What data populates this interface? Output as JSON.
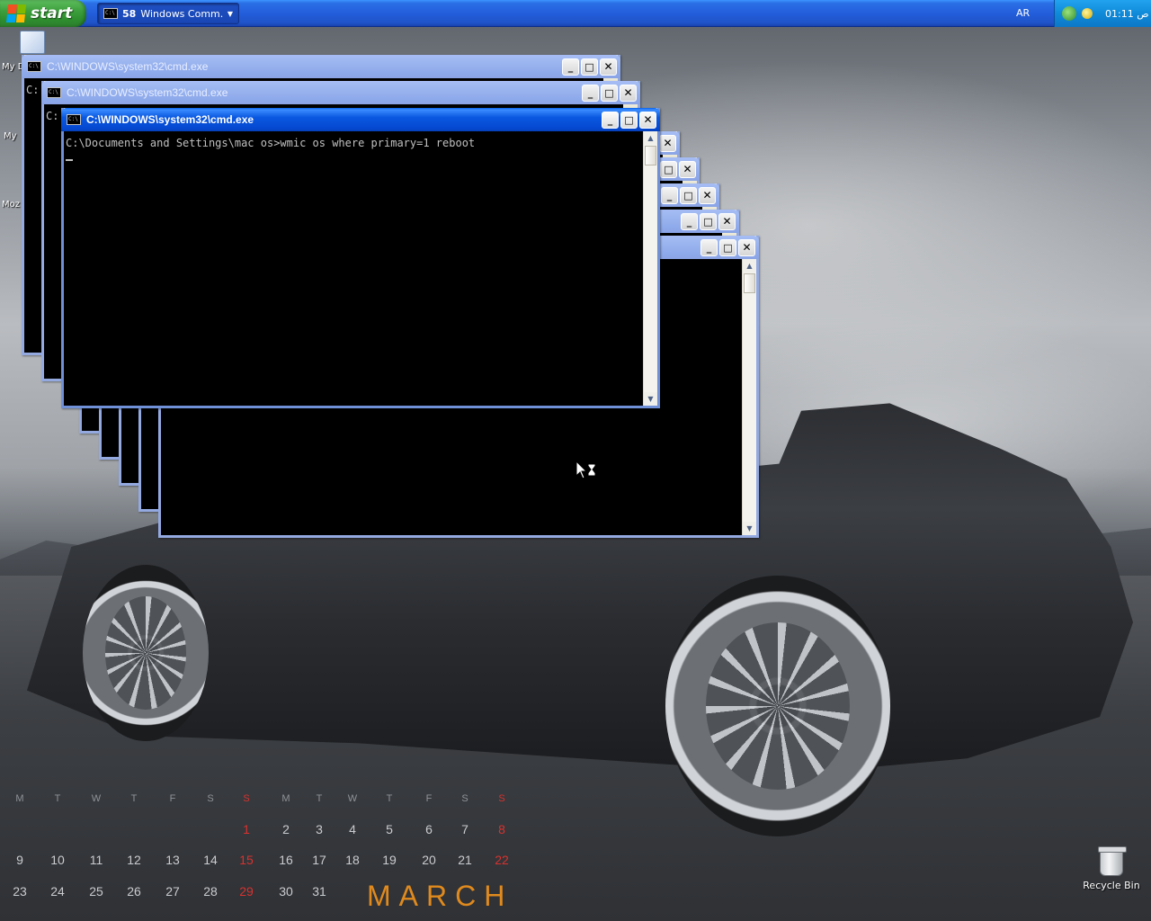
{
  "taskbar": {
    "start_label": "start",
    "task_button": {
      "count": "58",
      "label": "Windows Comm...",
      "icon": "cmd-icon"
    },
    "language": "AR",
    "clock": "01:11",
    "clock_suffix": "ص"
  },
  "desktop": {
    "icon_labels": [
      "My D",
      "My",
      "Moz"
    ]
  },
  "windows": {
    "back1_title": "C:\\WINDOWS\\system32\\cmd.exe",
    "back2_title": "C:\\WINDOWS\\system32\\cmd.exe",
    "front_title": "C:\\WINDOWS\\system32\\cmd.exe",
    "back_console_text": "C:",
    "front_console_text": "C:\\Documents and Settings\\mac os>wmic os where primary=1 reboot"
  },
  "title_buttons": {
    "minimize": "_",
    "maximize": "□",
    "close": "✕"
  },
  "calendar": {
    "weekday_headers": [
      "M",
      "T",
      "W",
      "T",
      "F",
      "S",
      "S",
      "M",
      "T",
      "W",
      "T",
      "F",
      "S",
      "S"
    ],
    "rows": [
      [
        "",
        "",
        "",
        "",
        "",
        "",
        "1",
        "2",
        "3",
        "4",
        "5",
        "6",
        "7",
        "8"
      ],
      [
        "9",
        "10",
        "11",
        "12",
        "13",
        "14",
        "15",
        "16",
        "17",
        "18",
        "19",
        "20",
        "21",
        "22"
      ],
      [
        "23",
        "24",
        "25",
        "26",
        "27",
        "28",
        "29",
        "30",
        "31",
        "",
        "",
        "",
        "",
        ""
      ]
    ],
    "month": "MARCH",
    "sunday_color": "#d8322f",
    "month_color": "#e08a1e"
  },
  "recycle_bin": {
    "label": "Recycle Bin"
  },
  "colors": {
    "taskbar_blue": "#245edb",
    "start_green": "#3c9f3c",
    "titlebar_active": "#0548d0",
    "console_text": "#c0c0c0"
  }
}
